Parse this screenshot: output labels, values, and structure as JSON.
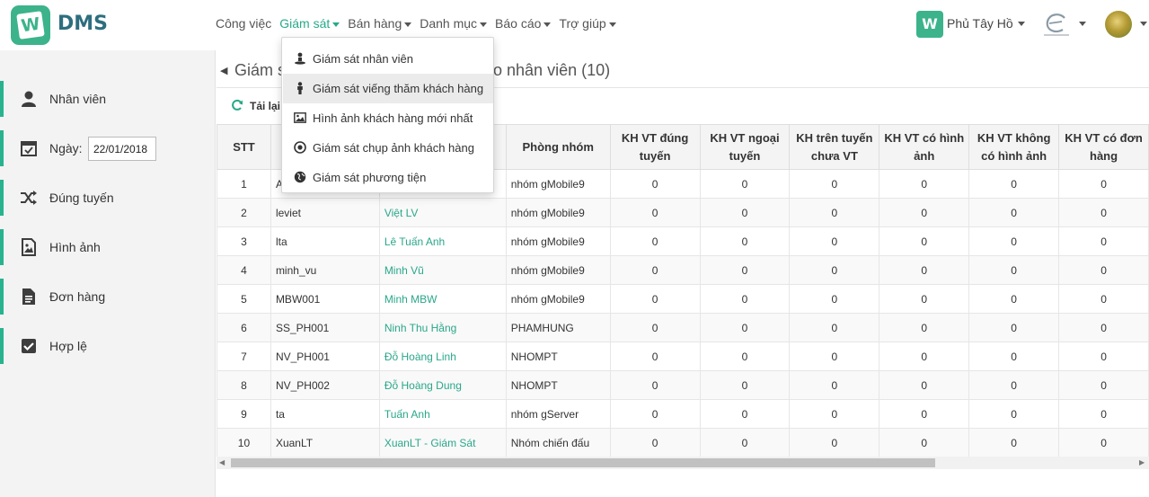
{
  "header": {
    "brand": "DMS",
    "nav": [
      {
        "label": "Công việc",
        "active": false
      },
      {
        "label": "Giám sát",
        "active": true
      },
      {
        "label": "Bán hàng",
        "active": false
      },
      {
        "label": "Danh mục",
        "active": false
      },
      {
        "label": "Báo cáo",
        "active": false
      },
      {
        "label": "Trợ giúp",
        "active": false
      }
    ],
    "company": "Phủ Tây Hồ"
  },
  "sidebar": {
    "items": [
      {
        "label": "Nhân viên",
        "icon": "user-icon"
      },
      {
        "label": "Ngày:",
        "icon": "calendar-icon",
        "value": "22/01/2018"
      },
      {
        "label": "Đúng tuyến",
        "icon": "shuffle-icon"
      },
      {
        "label": "Hình ảnh",
        "icon": "image-file-icon"
      },
      {
        "label": "Đơn hàng",
        "icon": "document-icon"
      },
      {
        "label": "Hợp lệ",
        "icon": "checkbox-icon"
      }
    ]
  },
  "main": {
    "title_prefix": "Giám s",
    "title_suffix": "eo nhân viên (10)",
    "reload_label": "Tải lại",
    "columns": [
      "STT",
      "",
      "",
      "Phòng nhóm",
      "KH VT đúng tuyến",
      "KH VT ngoại tuyến",
      "KH trên tuyến chưa VT",
      "KH VT có hình ảnh",
      "KH VT không có hình ảnh",
      "KH VT có đơn hàng"
    ],
    "rows": [
      [
        "1",
        "A",
        "",
        "nhóm gMobile9",
        "0",
        "0",
        "0",
        "0",
        "0",
        "0"
      ],
      [
        "2",
        "leviet",
        "Việt LV",
        "nhóm gMobile9",
        "0",
        "0",
        "0",
        "0",
        "0",
        "0"
      ],
      [
        "3",
        "lta",
        "Lê Tuấn Anh",
        "nhóm gMobile9",
        "0",
        "0",
        "0",
        "0",
        "0",
        "0"
      ],
      [
        "4",
        "minh_vu",
        "Minh Vũ",
        "nhóm gMobile9",
        "0",
        "0",
        "0",
        "0",
        "0",
        "0"
      ],
      [
        "5",
        "MBW001",
        "Minh MBW",
        "nhóm gMobile9",
        "0",
        "0",
        "0",
        "0",
        "0",
        "0"
      ],
      [
        "6",
        "SS_PH001",
        "Ninh Thu Hằng",
        "PHAMHUNG",
        "0",
        "0",
        "0",
        "0",
        "0",
        "0"
      ],
      [
        "7",
        "NV_PH001",
        "Đỗ Hoàng Linh",
        "NHOMPT",
        "0",
        "0",
        "0",
        "0",
        "0",
        "0"
      ],
      [
        "8",
        "NV_PH002",
        "Đỗ Hoàng Dung",
        "NHOMPT",
        "0",
        "0",
        "0",
        "0",
        "0",
        "0"
      ],
      [
        "9",
        "ta",
        "Tuấn Anh",
        "nhóm gServer",
        "0",
        "0",
        "0",
        "0",
        "0",
        "0"
      ],
      [
        "10",
        "XuanLT",
        "XuanLT - Giám Sát",
        "Nhóm chiến đấu",
        "0",
        "0",
        "0",
        "0",
        "0",
        "0"
      ]
    ]
  },
  "dropdown": {
    "items": [
      {
        "label": "Giám sát nhân viên",
        "icon": "person-pin-icon"
      },
      {
        "label": "Giám sát viếng thăm khách hàng",
        "icon": "person-icon",
        "hover": true
      },
      {
        "label": "Hình ảnh khách hàng mới nhất",
        "icon": "picture-icon"
      },
      {
        "label": "Giám sát chụp ảnh khách hàng",
        "icon": "camera-icon"
      },
      {
        "label": "Giám sát phương tiện",
        "icon": "globe-icon"
      }
    ]
  },
  "colors": {
    "accent": "#28a98a",
    "brand": "#3cb38b"
  }
}
